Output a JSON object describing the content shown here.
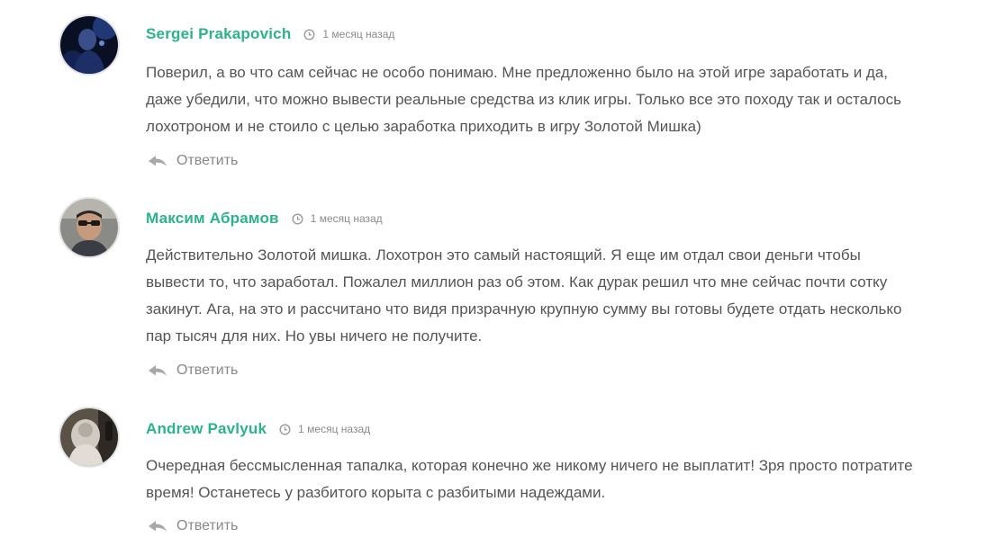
{
  "comments": [
    {
      "author": "Sergei Prakapovich",
      "time": "1 месяц назад",
      "text": "Поверил, а во что сам сейчас не особо понимаю. Мне предложенно было на этой игре заработать и да, даже убедили, что можно вывести реальные средства из клик игры. Только все это походу так и осталось лохотроном и не стоило с целью заработка приходить в игру Золотой Мишка)",
      "reply_label": "Ответить"
    },
    {
      "author": "Максим Абрамов",
      "time": "1 месяц назад",
      "text": "Действительно Золотой мишка. Лохотрон это самый настоящий. Я еще им отдал свои деньги чтобы вывести то, что заработал. Пожалел миллион раз об этом. Как дурак решил что мне сейчас почти сотку закинут. Ага, на это и рассчитано что видя призрачную крупную сумму вы готовы будете отдать несколько пар тысяч для них. Но увы ничего не получите.",
      "reply_label": "Ответить"
    },
    {
      "author": "Andrew Pavlyuk",
      "time": "1 месяц назад",
      "text": "Очередная бессмысленная тапалка, которая конечно же никому ничего не выплатит! Зря просто потратите время! Останетесь у разбитого корыта с разбитыми надеждами.",
      "reply_label": "Ответить"
    }
  ],
  "colors": {
    "author": "#2bb38b",
    "text": "#555555",
    "muted": "#888888",
    "avatar_border": "#e3e3e3"
  },
  "icons": {
    "time": "clock-icon",
    "reply": "reply-arrow-icon"
  }
}
